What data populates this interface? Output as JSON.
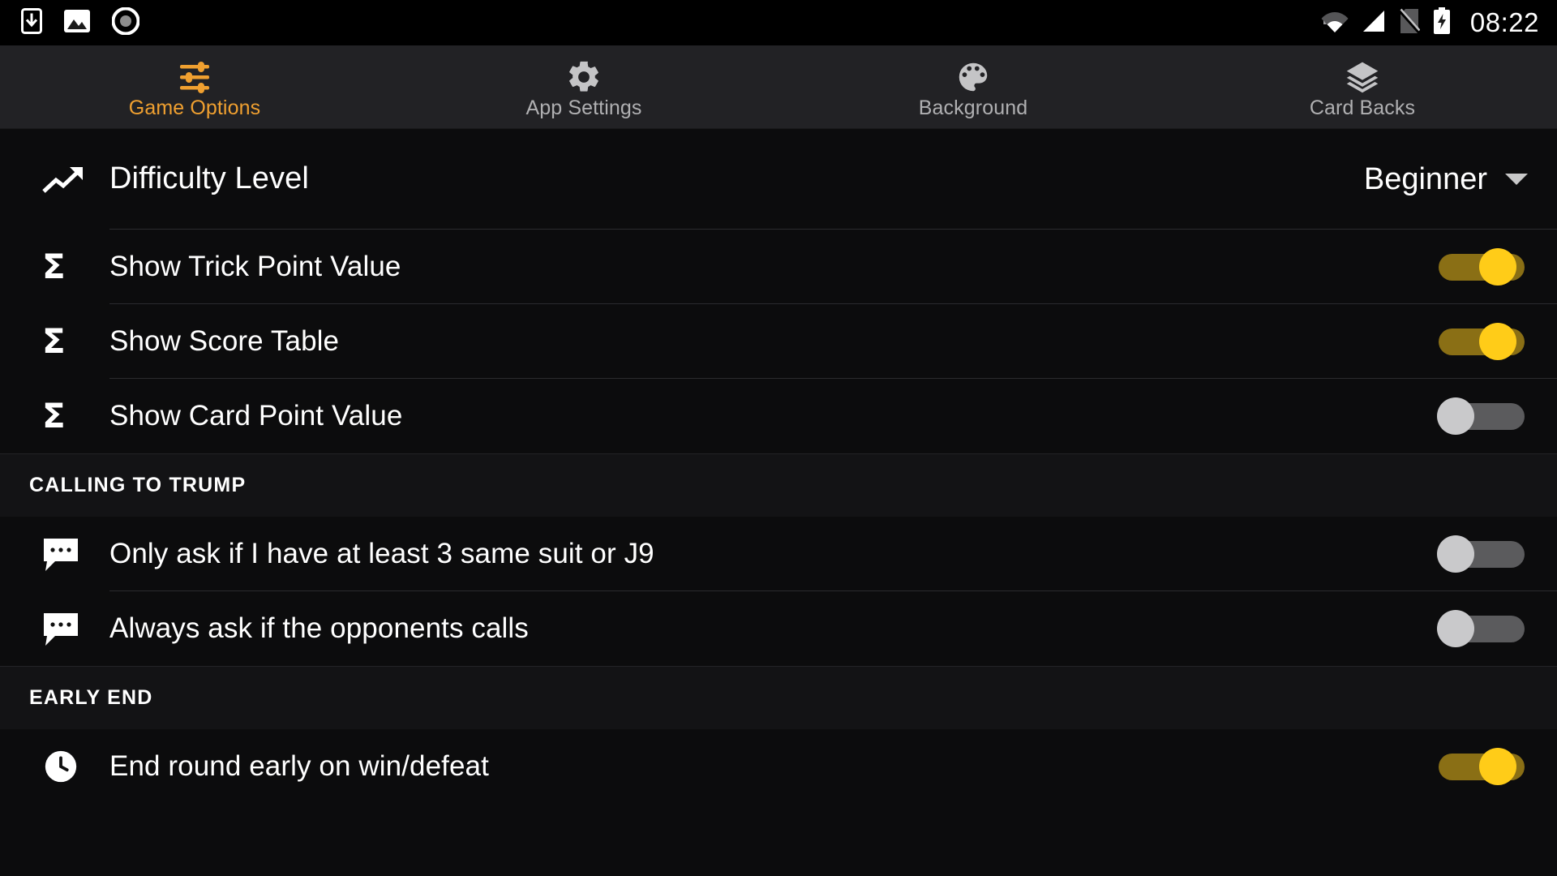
{
  "status_bar": {
    "time": "08:22",
    "left_icons": [
      "download-to-phone-icon",
      "image-icon",
      "record-icon"
    ],
    "right_icons": [
      "wifi-icon",
      "cell-signal-icon",
      "no-sim-icon",
      "battery-charging-icon"
    ],
    "background_color": "#000000"
  },
  "tabs": [
    {
      "label": "Game Options",
      "icon": "sliders-icon",
      "active": true
    },
    {
      "label": "App Settings",
      "icon": "gear-icon",
      "active": false
    },
    {
      "label": "Background",
      "icon": "palette-icon",
      "active": false
    },
    {
      "label": "Card Backs",
      "icon": "layers-icon",
      "active": false
    }
  ],
  "theme": {
    "accent": "#f0a030",
    "toggle_on_thumb": "#ffcc18",
    "toggle_on_track": "#8a6f15",
    "toggle_off_thumb": "#c9c9cb",
    "toggle_off_track": "#5b5b5d",
    "page_background": "#0c0c0d",
    "tabbar_background": "#222225"
  },
  "list": [
    {
      "type": "dropdown",
      "icon": "trending-up-icon",
      "label": "Difficulty Level",
      "value": "Beginner"
    },
    {
      "type": "switch",
      "icon": "sigma-icon",
      "label": "Show Trick Point Value",
      "state": "on"
    },
    {
      "type": "switch",
      "icon": "sigma-icon",
      "label": "Show Score Table",
      "state": "on"
    },
    {
      "type": "switch",
      "icon": "sigma-icon",
      "label": "Show Card Point Value",
      "state": "off"
    },
    {
      "type": "section",
      "label": "CALLING TO TRUMP"
    },
    {
      "type": "switch",
      "icon": "chat-bubble-icon",
      "label": "Only ask if I have at least 3 same suit or J9",
      "state": "off"
    },
    {
      "type": "switch",
      "icon": "chat-bubble-icon",
      "label": "Always ask if the opponents calls",
      "state": "off"
    },
    {
      "type": "section",
      "label": "EARLY END"
    },
    {
      "type": "switch",
      "icon": "clock-icon",
      "label": "End round early on win/defeat",
      "state": "on"
    }
  ]
}
